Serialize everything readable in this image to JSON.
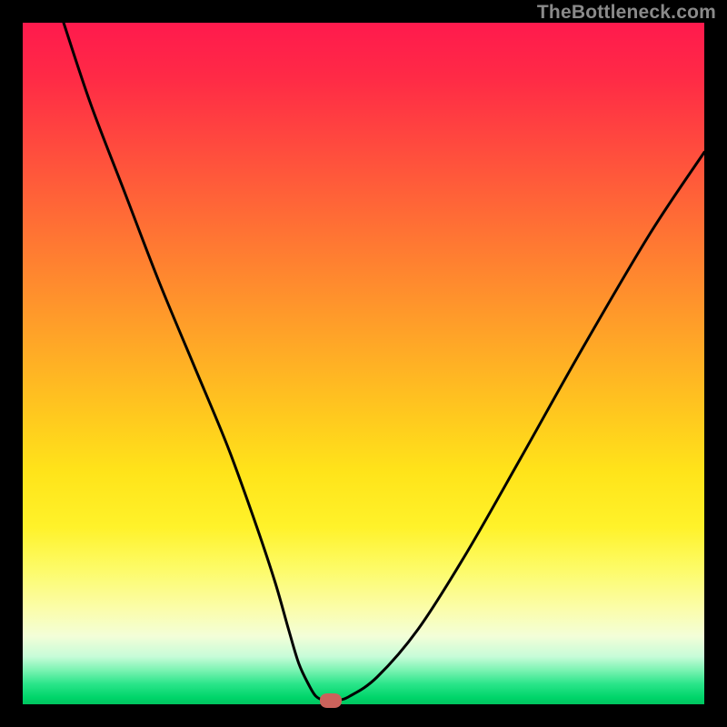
{
  "watermark": "TheBottleneck.com",
  "chart_data": {
    "type": "line",
    "title": "",
    "xlabel": "",
    "ylabel": "",
    "xlim": [
      0,
      100
    ],
    "ylim": [
      0,
      100
    ],
    "grid": false,
    "legend": false,
    "background": "warm-gradient",
    "series": [
      {
        "name": "bottleneck-curve",
        "x": [
          6,
          10,
          15,
          20,
          25,
          30,
          34,
          37,
          39,
          40.5,
          42,
          43,
          44.2,
          46.2,
          48,
          52,
          58,
          65,
          73,
          82,
          92,
          100
        ],
        "y": [
          100,
          88,
          75,
          62,
          50,
          38,
          27,
          18,
          11,
          6,
          2.8,
          1.2,
          0.6,
          0.6,
          1.2,
          4,
          11,
          22,
          36,
          52,
          69,
          81
        ]
      }
    ],
    "markers": [
      {
        "name": "highlight",
        "x": 45.2,
        "y": 0.6,
        "color": "#cb625b"
      }
    ],
    "gradient_stops": [
      {
        "pos": 0,
        "color": "#ff1a4d"
      },
      {
        "pos": 50,
        "color": "#ffca1e"
      },
      {
        "pos": 80,
        "color": "#fdfb66"
      },
      {
        "pos": 100,
        "color": "#00c45f"
      }
    ]
  },
  "layout": {
    "image_size": 800,
    "plot_inset": 25,
    "plot_size": 750
  }
}
